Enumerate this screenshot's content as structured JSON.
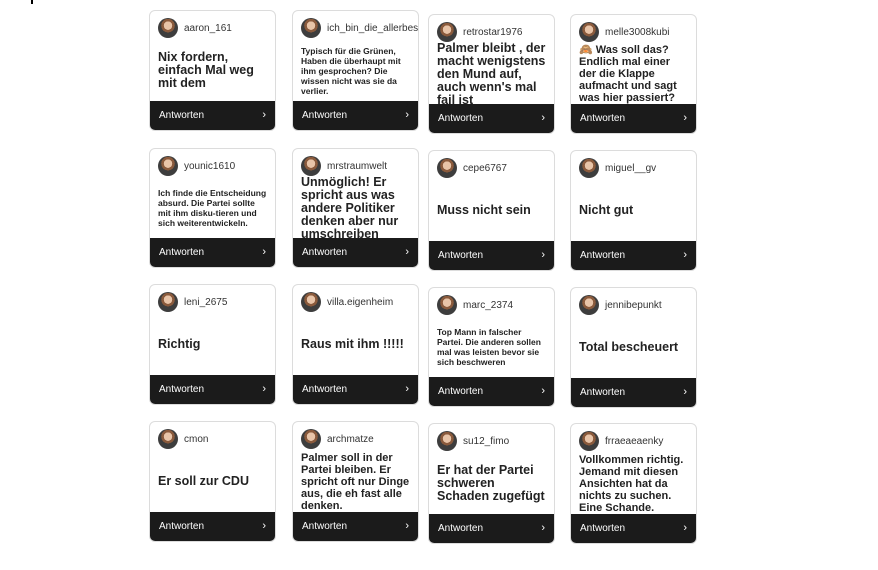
{
  "reply_label": "Antworten",
  "icons": {
    "avatar": "avatar-icon",
    "chevron": "chevron-right-icon"
  },
  "colors": {
    "reply_bar": "#1b1b1b",
    "card_border": "#dcdcdc"
  },
  "cards": [
    {
      "user": "aaron_161",
      "text": "Nix fordern, einfach Mal weg mit dem"
    },
    {
      "user": "ich_bin_die_allerbeste",
      "text": "Typisch für die Grünen, Haben die überhaupt mit ihm gesprochen?  Die wissen nicht was sie da verlier."
    },
    {
      "user": "retrostar1976",
      "text": "Palmer bleibt , der macht wenigstens den Mund auf, auch wenn's mal fail ist"
    },
    {
      "user": "melle3008kubi",
      "text": "🙈 Was soll das? Endlich mal einer der die Klappe aufmacht und sagt was hier passiert?"
    },
    {
      "user": "younic1610",
      "text": "Ich finde die Entscheidung absurd. Die Partei sollte mit ihm disku-tieren und sich weiterentwickeln."
    },
    {
      "user": "mrstraumwelt",
      "text": "Unmöglich! Er spricht aus was andere Politiker denken aber nur umschreiben"
    },
    {
      "user": "cepe6767",
      "text": "Muss nicht sein"
    },
    {
      "user": "miguel__gv",
      "text": "Nicht gut"
    },
    {
      "user": "leni_2675",
      "text": "Richtig"
    },
    {
      "user": "villa.eigenheim",
      "text": "Raus mit ihm !!!!!"
    },
    {
      "user": "marc_2374",
      "text": "Top Mann in falscher Partei. Die anderen sollen mal was leisten bevor sie sich beschweren"
    },
    {
      "user": "jennibepunkt",
      "text": "Total bescheuert"
    },
    {
      "user": "cmon",
      "text": "Er soll zur CDU"
    },
    {
      "user": "archmatze",
      "text": "Palmer soll in der Partei bleiben. Er spricht oft nur Dinge aus, die eh fast alle denken."
    },
    {
      "user": "su12_fimo",
      "text": "Er hat der Partei schweren Schaden zugefügt"
    },
    {
      "user": "frraeaeaenky",
      "text": "Vollkommen richtig. Jemand mit diesen Ansichten hat da nichts zu suchen. Eine Schande."
    }
  ]
}
